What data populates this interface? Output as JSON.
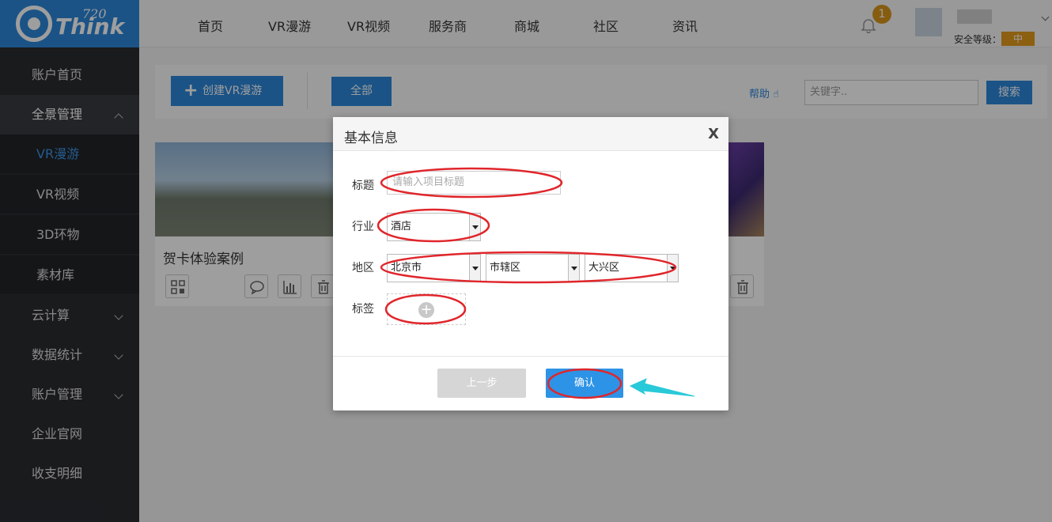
{
  "brand": {
    "logo_number": "720",
    "logo_word": "Think"
  },
  "top_nav": [
    "首页",
    "VR漫游",
    "VR视频",
    "服务商",
    "商城",
    "社区",
    "资讯"
  ],
  "notifications": {
    "count": "1"
  },
  "account": {
    "security_label": "安全等级：",
    "security_level": "中"
  },
  "sidebar": {
    "items": [
      {
        "label": "账户首页"
      },
      {
        "label": "全景管理"
      },
      {
        "label": "VR漫游"
      },
      {
        "label": "VR视频"
      },
      {
        "label": "3D环物"
      },
      {
        "label": "素材库"
      },
      {
        "label": "云计算"
      },
      {
        "label": "数据统计"
      },
      {
        "label": "账户管理"
      },
      {
        "label": "企业官网"
      },
      {
        "label": "收支明细"
      }
    ]
  },
  "toolbar": {
    "create_label": "创建VR漫游",
    "all_label": "全部",
    "help_label": "帮助",
    "search_placeholder": "关键字..",
    "search_label": "搜索"
  },
  "projects": [
    {
      "title": "贺卡体验案例"
    }
  ],
  "modal": {
    "title": "基本信息",
    "close": "X",
    "title_label": "标题",
    "title_placeholder": "请输入项目标题",
    "industry_label": "行业",
    "industry_value": "酒店",
    "region_label": "地区",
    "province_value": "北京市",
    "city_value": "市辖区",
    "district_value": "大兴区",
    "tags_label": "标签",
    "tag_add": "+",
    "prev_label": "上一步",
    "confirm_label": "确认"
  },
  "colors": {
    "primary": "#2d86d8",
    "sidebar": "#2a2c30",
    "warning": "#e39a1c",
    "annotation_red": "#e0262b",
    "annotation_arrow": "#28c9d8"
  }
}
